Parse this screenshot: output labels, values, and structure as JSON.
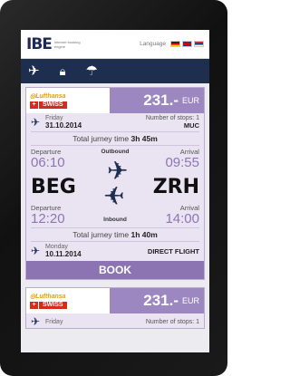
{
  "header": {
    "logo": "IBE",
    "logo_tagline": "Internet booking engine",
    "language_label": "Language",
    "flags": [
      "de-flag",
      "gb-flag",
      "rs-flag"
    ]
  },
  "nav": {
    "icons": [
      "flight-icon",
      "baggage-icon",
      "beach-icon"
    ]
  },
  "results": [
    {
      "airlines": [
        "Lufthansa",
        "SWISS"
      ],
      "price": "231.-",
      "currency": "EUR",
      "outbound": {
        "day": "Friday",
        "date": "31.10.2014",
        "stops_label": "Number of stops: 1",
        "stop_airport": "MUC",
        "total_label": "Total jurney time",
        "total_time": "3h 45m",
        "departure_label": "Departure",
        "departure_time": "06:10",
        "direction": "Outbound",
        "arrival_label": "Arrival",
        "arrival_time": "09:55"
      },
      "from": "BEG",
      "to": "ZRH",
      "inbound": {
        "departure_label": "Departure",
        "departure_time": "12:20",
        "direction": "Inbound",
        "arrival_label": "Arrival",
        "arrival_time": "14:00",
        "total_label": "Total jurney time",
        "total_time": "1h 40m",
        "day": "Monday",
        "date": "10.11.2014",
        "flight_type": "DIRECT FLIGHT"
      },
      "book_label": "BOOK"
    },
    {
      "airlines": [
        "Lufthansa",
        "SWISS"
      ],
      "price": "231.-",
      "currency": "EUR",
      "outbound": {
        "day": "Friday",
        "stops_label": "Number of stops: 1"
      }
    }
  ]
}
